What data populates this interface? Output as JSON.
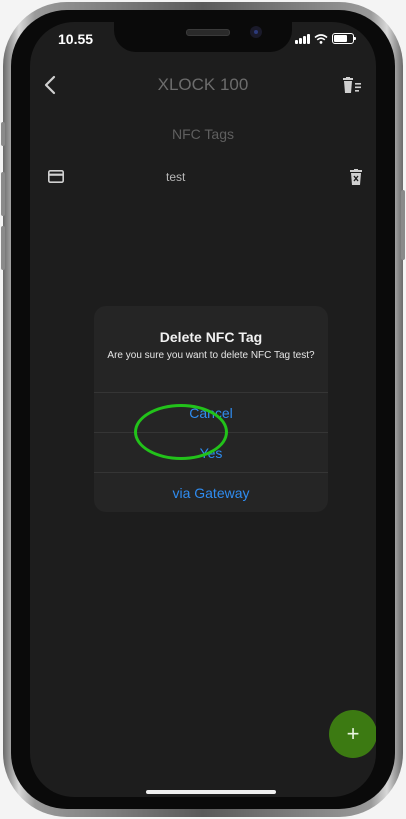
{
  "status_bar": {
    "time": "10.55"
  },
  "header": {
    "title": "XLOCK 100"
  },
  "section": {
    "title": "NFC Tags"
  },
  "nfc_tags": [
    {
      "name": "test"
    }
  ],
  "dialog": {
    "title": "Delete NFC Tag",
    "message": "Are you sure you want to delete NFC Tag test?",
    "actions": [
      "Cancel",
      "Yes",
      "via Gateway"
    ]
  },
  "fab": {
    "label": "+"
  },
  "colors": {
    "accent_blue": "#2f8cf0",
    "fab_green": "#3c7a12",
    "highlight_green": "#22c21a",
    "background": "#1d1d1d"
  },
  "icons": {
    "back": "chevron-left-icon",
    "delete_all": "trash-list-icon",
    "card": "credit-card-icon",
    "row_delete": "trash-x-icon"
  }
}
